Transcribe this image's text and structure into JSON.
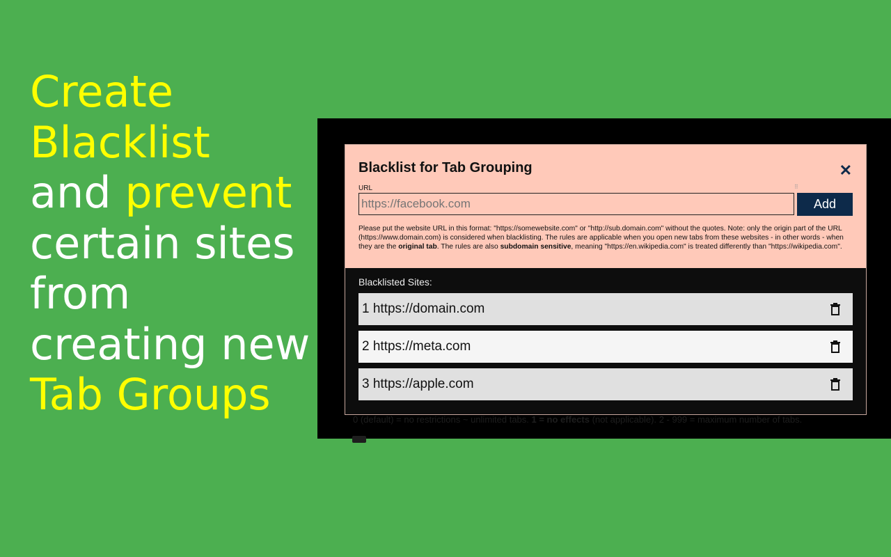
{
  "headline": {
    "w1": "Create",
    "w2": "Blacklist",
    "w3": "and",
    "w4": "prevent",
    "w5": "certain sites from creating new",
    "w6": "Tab Groups"
  },
  "background_page": {
    "hint_pre": "0 (default) = no restrictions ~ unlimited tabs. ",
    "hint_bold": "1 = no effects",
    "hint_post": " (not applicable). 2 - 999 = maximum number of tabs."
  },
  "modal": {
    "title": "Blacklist for Tab Grouping",
    "close_icon": "close-icon",
    "url_label": "URL",
    "url_placeholder": "https://facebook.com",
    "add_label": "Add",
    "help": {
      "p1": "Please put the website URL in this format: \"https://somewebsite.com\" or \"http://sub.domain.com\" without the quotes. Note: only the origin part of the URL (https://www.domain.com) is considered when blacklisting. The rules are applicable when you open new tabs from these websites - in other words - when they are the ",
      "b1": "original tab",
      "p2": ". The rules are also ",
      "b2": "subdomain sensitive",
      "p3": ", meaning \"https://en.wikipedia.com\" is treated differently than \"https://wikipedia.com\"."
    },
    "list_label": "Blacklisted Sites:",
    "sites": [
      {
        "label": "1 https://domain.com",
        "bg": "#e0e0e0"
      },
      {
        "label": "2 https://meta.com",
        "bg": "#f5f5f5"
      },
      {
        "label": "3 https://apple.com",
        "bg": "#e0e0e0"
      }
    ]
  },
  "colors": {
    "background": "#4caf50",
    "highlight": "#ffff00",
    "modal_header": "#ffc9b9",
    "button": "#0d2a4a"
  }
}
